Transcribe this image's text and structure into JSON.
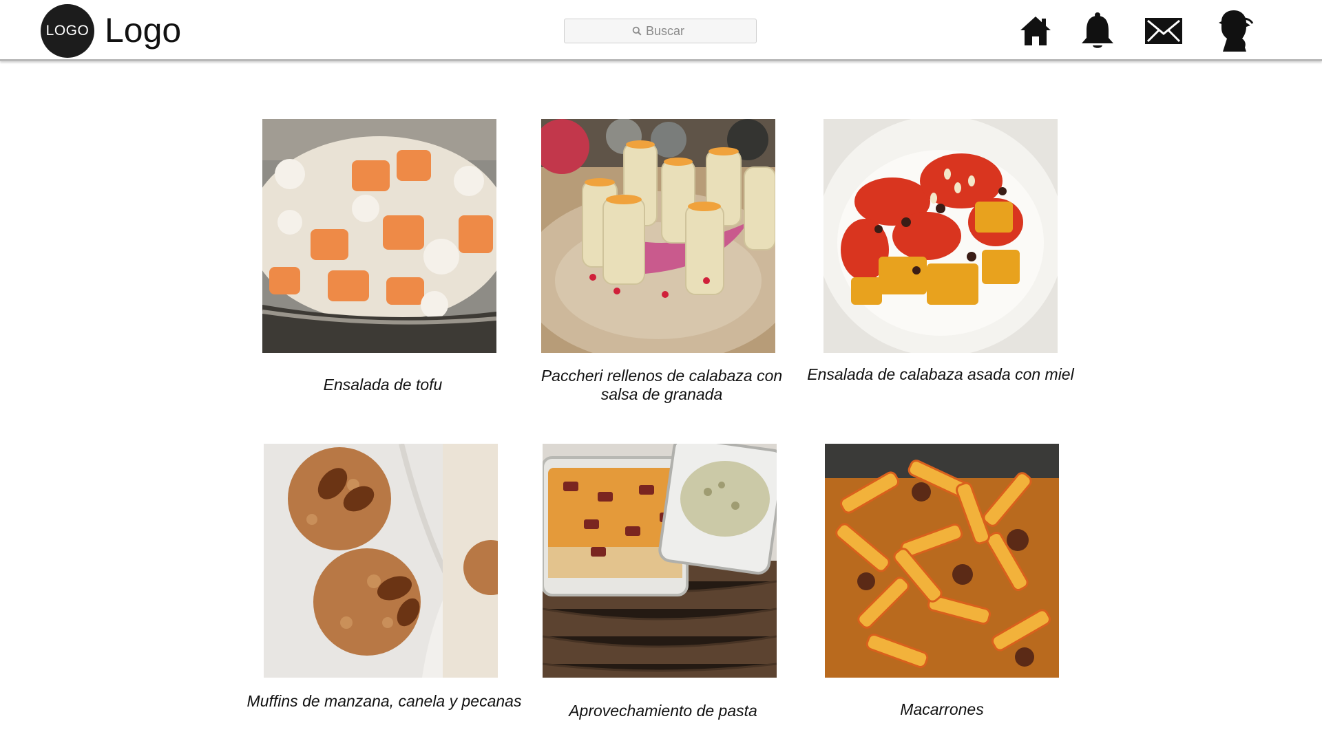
{
  "header": {
    "logo_badge": "LOGO",
    "logo_text": "Logo",
    "search_placeholder": "Buscar",
    "icons": [
      "search-icon",
      "home-icon",
      "bell-icon",
      "mail-icon",
      "profile-icon"
    ]
  },
  "recipes": [
    {
      "title": "Ensalada de tofu",
      "image": "ensalada-de-tofu-photo"
    },
    {
      "title": "Paccheri rellenos de calabaza con salsa de granada",
      "image": "paccheri-photo"
    },
    {
      "title": "Ensalada de calabaza asada con miel",
      "image": "calabaza-asada-photo"
    },
    {
      "title": "Muffins de manzana, canela y pecanas",
      "image": "muffins-photo"
    },
    {
      "title": "Aprovechamiento de pasta",
      "image": "pasta-bake-photo"
    },
    {
      "title": "Macarrones",
      "image": "macarrones-photo"
    }
  ],
  "colors": {
    "logo_circle": "#1c1c1c",
    "header_border": "#b8b8b8",
    "icon": "#111111"
  }
}
